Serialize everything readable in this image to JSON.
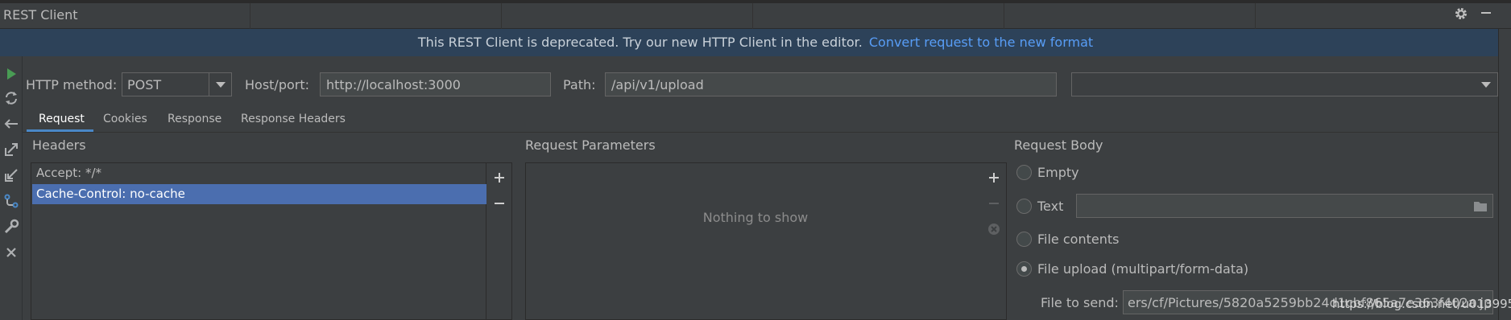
{
  "window": {
    "title": "REST Client"
  },
  "banner": {
    "message": "This REST Client is deprecated. Try our new HTTP Client in the editor.",
    "link": "Convert request to the new format"
  },
  "request": {
    "method_label": "HTTP method:",
    "method_value": "POST",
    "host_label": "Host/port:",
    "host_value": "http://localhost:3000",
    "path_label": "Path:",
    "path_value": "/api/v1/upload",
    "extra_combo_value": ""
  },
  "tabs": [
    {
      "label": "Request",
      "active": true
    },
    {
      "label": "Cookies",
      "active": false
    },
    {
      "label": "Response",
      "active": false
    },
    {
      "label": "Response Headers",
      "active": false
    }
  ],
  "headers": {
    "title": "Headers",
    "items": [
      {
        "text": "Accept: */*",
        "selected": false
      },
      {
        "text": "Cache-Control: no-cache",
        "selected": true
      }
    ]
  },
  "params": {
    "title": "Request Parameters",
    "empty_text": "Nothing to show"
  },
  "body": {
    "title": "Request Body",
    "options": [
      {
        "label": "Empty",
        "checked": false
      },
      {
        "label": "Text",
        "checked": false
      },
      {
        "label": "File contents",
        "checked": false
      },
      {
        "label": "File upload (multipart/form-data)",
        "checked": true
      }
    ],
    "file_label": "File to send:",
    "file_value": "ers/cf/Pictures/5820a5259bb24d1cbf865a7e363f402a.jpg"
  },
  "watermark": "https://blog.csdn.net/u013995",
  "colors": {
    "background": "#3c3f41",
    "banner": "#2d4259",
    "link": "#589df6",
    "selection": "#4b6eaf",
    "run_green": "#499c54"
  }
}
